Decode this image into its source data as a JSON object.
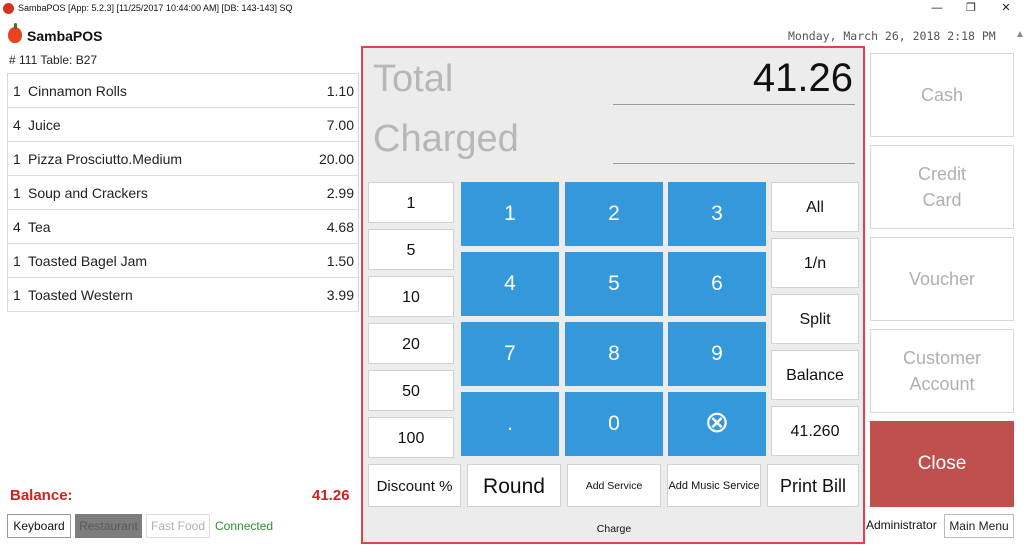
{
  "window": {
    "title": "SambaPOS [App: 5.2.3] [11/25/2017 10:44:00 AM] [DB: 143-143] SQ",
    "min_glyph": "—",
    "restore_glyph": "❐",
    "close_glyph": "✕"
  },
  "header": {
    "logo": "SambaPOS",
    "datetime": "Monday, March 26, 2018 2:18 PM",
    "ticket": "# 111 Table: B27"
  },
  "orders": [
    {
      "qty": "1",
      "name": "Cinnamon Rolls",
      "price": "1.10"
    },
    {
      "qty": "4",
      "name": "Juice",
      "price": "7.00"
    },
    {
      "qty": "1",
      "name": "Pizza Prosciutto.Medium",
      "price": "20.00"
    },
    {
      "qty": "1",
      "name": "Soup and Crackers",
      "price": "2.99"
    },
    {
      "qty": "4",
      "name": "Tea",
      "price": "4.68"
    },
    {
      "qty": "1",
      "name": "Toasted Bagel Jam",
      "price": "1.50"
    },
    {
      "qty": "1",
      "name": "Toasted Western",
      "price": "3.99"
    }
  ],
  "balance": {
    "label": "Balance:",
    "value": "41.26"
  },
  "footer": {
    "keyboard": "Keyboard",
    "restaurant": "Restaurant",
    "fast_food": "Fast Food",
    "status": "Connected",
    "user": "Administrator",
    "main_menu": "Main Menu"
  },
  "payment": {
    "total_label": "Total",
    "total_value": "41.26",
    "charged_label": "Charged",
    "quick_amounts": [
      "1",
      "5",
      "10",
      "20",
      "50",
      "100"
    ],
    "keypad": [
      "1",
      "2",
      "3",
      "4",
      "5",
      "6",
      "7",
      "8",
      "9",
      ".",
      "0"
    ],
    "clear_glyph": "⊗",
    "split_buttons": [
      "All",
      "1/n",
      "Split",
      "Balance",
      "41.260"
    ],
    "bottom": {
      "discount": "Discount %",
      "round": "Round",
      "service_charge": "Add Service Charge",
      "music_service": "Add Music Service",
      "print_bill": "Print Bill"
    }
  },
  "payment_types": {
    "cash": "Cash",
    "credit_card": "Credit Card",
    "voucher": "Voucher",
    "customer_account": "Customer Account",
    "close": "Close"
  },
  "colors": {
    "keypad_blue": "#3598db",
    "close_red": "#c0504d",
    "balance_red": "#d0221c",
    "panel_border": "#e0434c",
    "connected_green": "#2f8f2f"
  }
}
